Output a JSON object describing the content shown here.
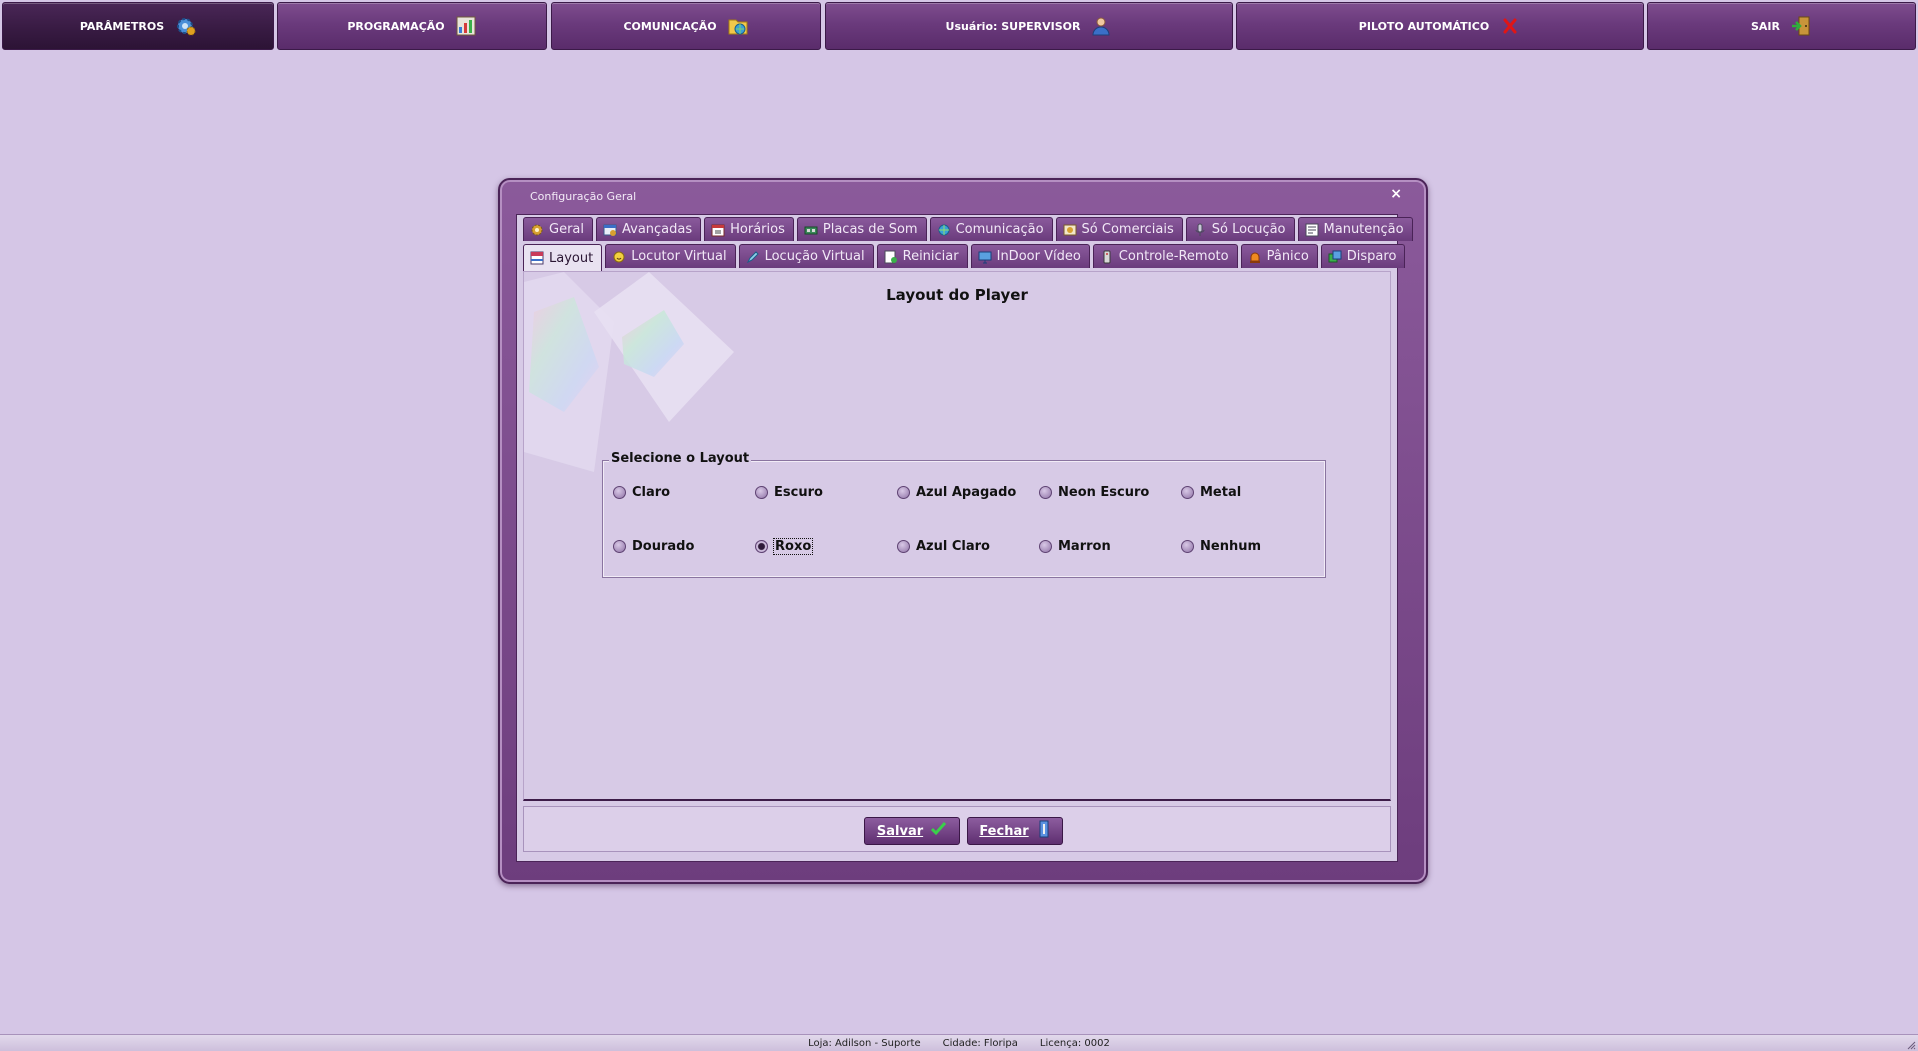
{
  "topmenu": {
    "parametros": "PARÂMETROS",
    "programacao": "PROGRAMAÇÃO",
    "comunicacao": "COMUNICAÇÃO",
    "usuario": "Usuário: SUPERVISOR",
    "piloto": "PILOTO AUTOMÁTICO",
    "sair": "SAIR"
  },
  "dialog": {
    "title": "Configuração Geral",
    "close": "×",
    "tabs_row1": [
      "Geral",
      "Avançadas",
      "Horários",
      "Placas de Som",
      "Comunicação",
      "Só Comerciais",
      "Só Locução",
      "Manutenção"
    ],
    "tabs_row2": [
      "Layout",
      "Locutor Virtual",
      "Locução Virtual",
      "Reiniciar",
      "InDoor Vídeo",
      "Controle-Remoto",
      "Pânico",
      "Disparo"
    ],
    "active_tab": "Layout",
    "panel_title": "Layout do Player",
    "group_label": "Selecione o Layout",
    "options": [
      "Claro",
      "Escuro",
      "Azul Apagado",
      "Neon Escuro",
      "Metal",
      "Dourado",
      "Roxo",
      "Azul Claro",
      "Marron",
      "Nenhum"
    ],
    "selected": "Roxo",
    "save": "Salvar",
    "close_button": "Fechar"
  },
  "status": {
    "loja": "Loja: Adilson - Suporte",
    "cidade": "Cidade: Floripa",
    "licenca": "Licença: 0002"
  },
  "colors": {
    "background": "#d5c6e6",
    "menu": "#6a3a7c",
    "menu_active": "#3a1c45",
    "panel": "#d7cae6"
  },
  "icons": {
    "parametros": "gear-icon",
    "programacao": "schedule-icon",
    "comunicacao": "folder-globe-icon",
    "usuario": "user-icon",
    "piloto": "red-x-icon",
    "sair": "exit-door-icon"
  }
}
